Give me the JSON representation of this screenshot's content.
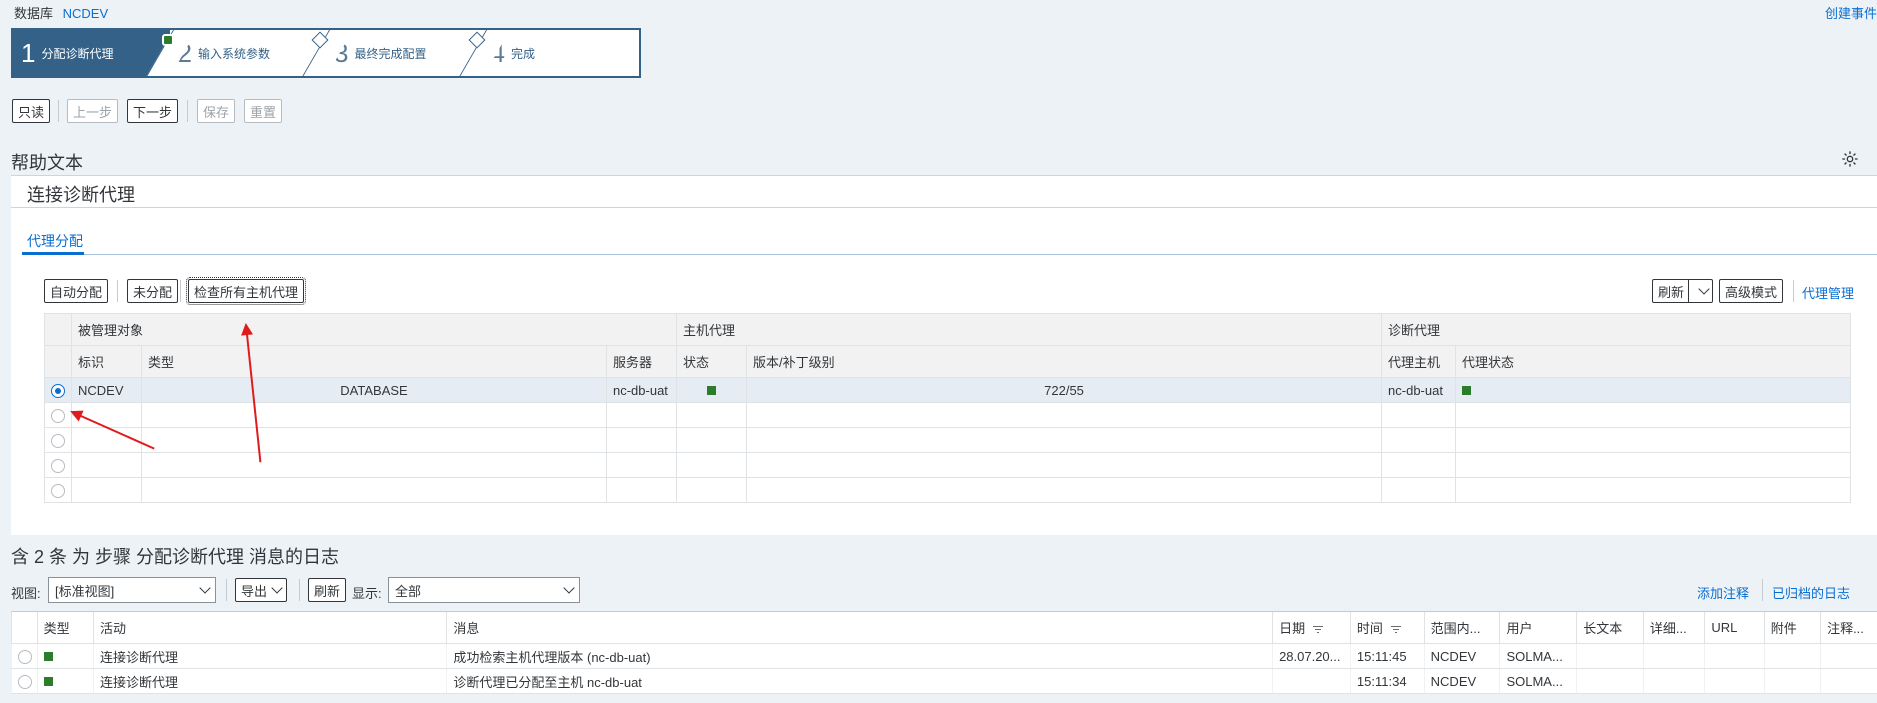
{
  "header": {
    "db_label": "数据库",
    "db_value": "NCDEV",
    "create_link": "创建事件"
  },
  "wizard": {
    "steps": [
      {
        "num": "1",
        "label": "分配诊断代理"
      },
      {
        "num": "2",
        "label": "输入系统参数"
      },
      {
        "num": "3",
        "label": "最终完成配置"
      },
      {
        "num": "4",
        "label": "完成"
      }
    ]
  },
  "toolbar": {
    "readonly": "只读",
    "prev": "上一步",
    "next": "下一步",
    "save": "保存",
    "reset": "重置"
  },
  "help_title": "帮助文本",
  "panel": {
    "title": "连接诊断代理",
    "tab": "代理分配",
    "buttons": {
      "auto": "自动分配",
      "unassign": "未分配",
      "check_all": "检查所有主机代理",
      "refresh": "刷新",
      "advanced": "高级模式",
      "agent_admin": "代理管理"
    },
    "groups": {
      "managed": "被管理对象",
      "host_agent": "主机代理",
      "diag_agent": "诊断代理"
    },
    "columns": {
      "id": "标识",
      "type": "类型",
      "server": "服务器",
      "status": "状态",
      "version": "版本/补丁级别",
      "agent_host": "代理主机",
      "agent_status": "代理状态"
    },
    "rows": [
      {
        "id": "NCDEV",
        "type": "DATABASE",
        "server": "nc-db-uat",
        "version": "722/55",
        "agent_host": "nc-db-uat"
      }
    ]
  },
  "log": {
    "title": "含 2 条 为 步骤 分配诊断代理 消息的日志",
    "view_label": "视图:",
    "view_value": "[标准视图]",
    "export": "导出",
    "refresh": "刷新",
    "show_label": "显示:",
    "show_value": "全部",
    "add_note": "添加注释",
    "archived_log": "已归档的日志",
    "columns": {
      "type": "类型",
      "activity": "活动",
      "message": "消息",
      "date": "日期",
      "time": "时间",
      "scope": "范围内...",
      "user": "用户",
      "long_text": "长文本",
      "detail": "详细...",
      "url": "URL",
      "attach": "附件",
      "note": "注释..."
    },
    "rows": [
      {
        "activity": "连接诊断代理",
        "message": "成功检索主机代理版本 (nc-db-uat)",
        "date": "28.07.20...",
        "time": "15:11:45",
        "scope": "NCDEV",
        "user": "SOLMA..."
      },
      {
        "activity": "连接诊断代理",
        "message": "诊断代理已分配至主机 nc-db-uat",
        "date": "",
        "time": "15:11:34",
        "scope": "NCDEV",
        "user": "SOLMA..."
      }
    ]
  },
  "colors": {
    "accent": "#0a6ed1",
    "wizard": "#346187",
    "ok": "#2b7d2b",
    "annotation": "#e01b1b"
  }
}
